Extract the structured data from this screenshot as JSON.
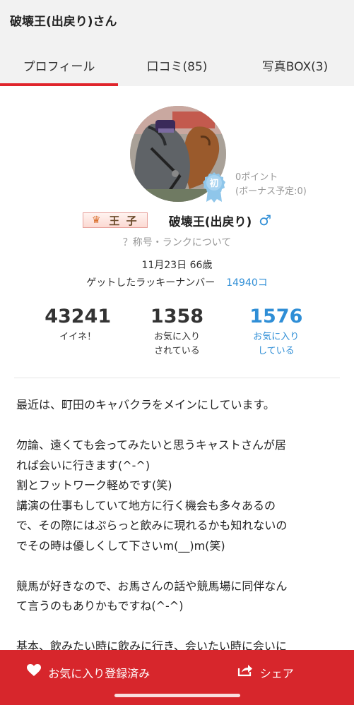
{
  "header": {
    "title": "破壊王(出戻り)さん"
  },
  "tabs": [
    {
      "label": "プロフィール",
      "active": true
    },
    {
      "label": "口コミ(85)",
      "active": false
    },
    {
      "label": "写真BOX(3)",
      "active": false
    }
  ],
  "profile": {
    "badge_label": "初",
    "points": "0ポイント",
    "bonus": "(ボーナス予定:0)",
    "rank_title": "王 子",
    "name": "破壊王(出戻り)",
    "gender_icon": "male-icon",
    "rank_help": "？称号・ランクについて",
    "birthday_age": "11月23日 66歳",
    "lucky_label": "ゲットしたラッキーナンバー",
    "lucky_value": "14940コ"
  },
  "stats": [
    {
      "value": "43241",
      "label1": "イイネ！",
      "label2": ""
    },
    {
      "value": "1358",
      "label1": "お気に入り",
      "label2": "されている"
    },
    {
      "value": "1576",
      "label1": "お気に入り",
      "label2": "している"
    }
  ],
  "intro": {
    "lines": [
      "最近は、町田のキャバクラをメインにしています。",
      "",
      "勿論、遠くても会ってみたいと思うキャストさんが居",
      "れば会いに行きます(^-^)",
      "割とフットワーク軽めです(笑)",
      "講演の仕事もしていて地方に行く機会も多々あるの",
      "で、その際にはぷらっと飲みに現れるかも知れないの",
      "でその時は優しくして下さいm(__)m(笑)",
      "",
      "競馬が好きなので、お馬さんの話や競馬場に同伴なん",
      "て言うのもありかもですね(^-^)",
      "",
      "基本、飲みたい時に飲みに行き、会いたい時に会いに"
    ]
  },
  "bottom_bar": {
    "favorite_label": "お気に入り登録済み",
    "share_label": "シェア"
  },
  "colors": {
    "accent": "#d7262c",
    "link": "#2f8ed6"
  }
}
